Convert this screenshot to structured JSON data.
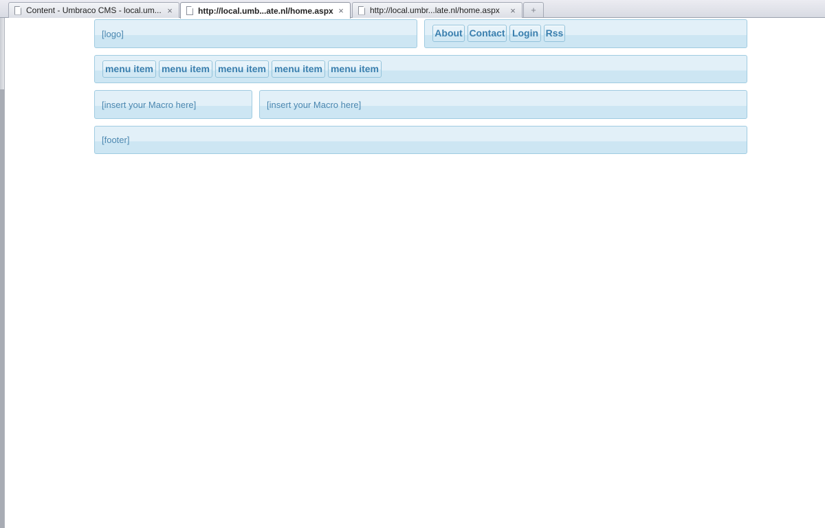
{
  "browser": {
    "tabs": [
      {
        "title": "Content - Umbraco CMS - local.um...",
        "close": "×",
        "active": false
      },
      {
        "title": "http://local.umb...ate.nl/home.aspx",
        "close": "×",
        "active": true
      },
      {
        "title": "http://local.umbr...late.nl/home.aspx",
        "close": "×",
        "active": false
      }
    ],
    "new_tab_label": "+"
  },
  "header": {
    "logo": "[logo]",
    "links": [
      "About",
      "Contact",
      "Login",
      "Rss"
    ]
  },
  "menu": {
    "items": [
      "menu item",
      "menu item",
      "menu item",
      "menu item",
      "menu item"
    ]
  },
  "content": {
    "sidebar_macro": "[insert your Macro here]",
    "main_macro": "[insert your Macro here]"
  },
  "footer": {
    "text": "[footer]"
  },
  "colors": {
    "box_border": "#9fcbe1",
    "box_fill_top": "#e2f0f8",
    "box_fill_bottom": "#cde6f3",
    "link_text": "#3a7fae",
    "placeholder_text": "#4a87b0"
  }
}
